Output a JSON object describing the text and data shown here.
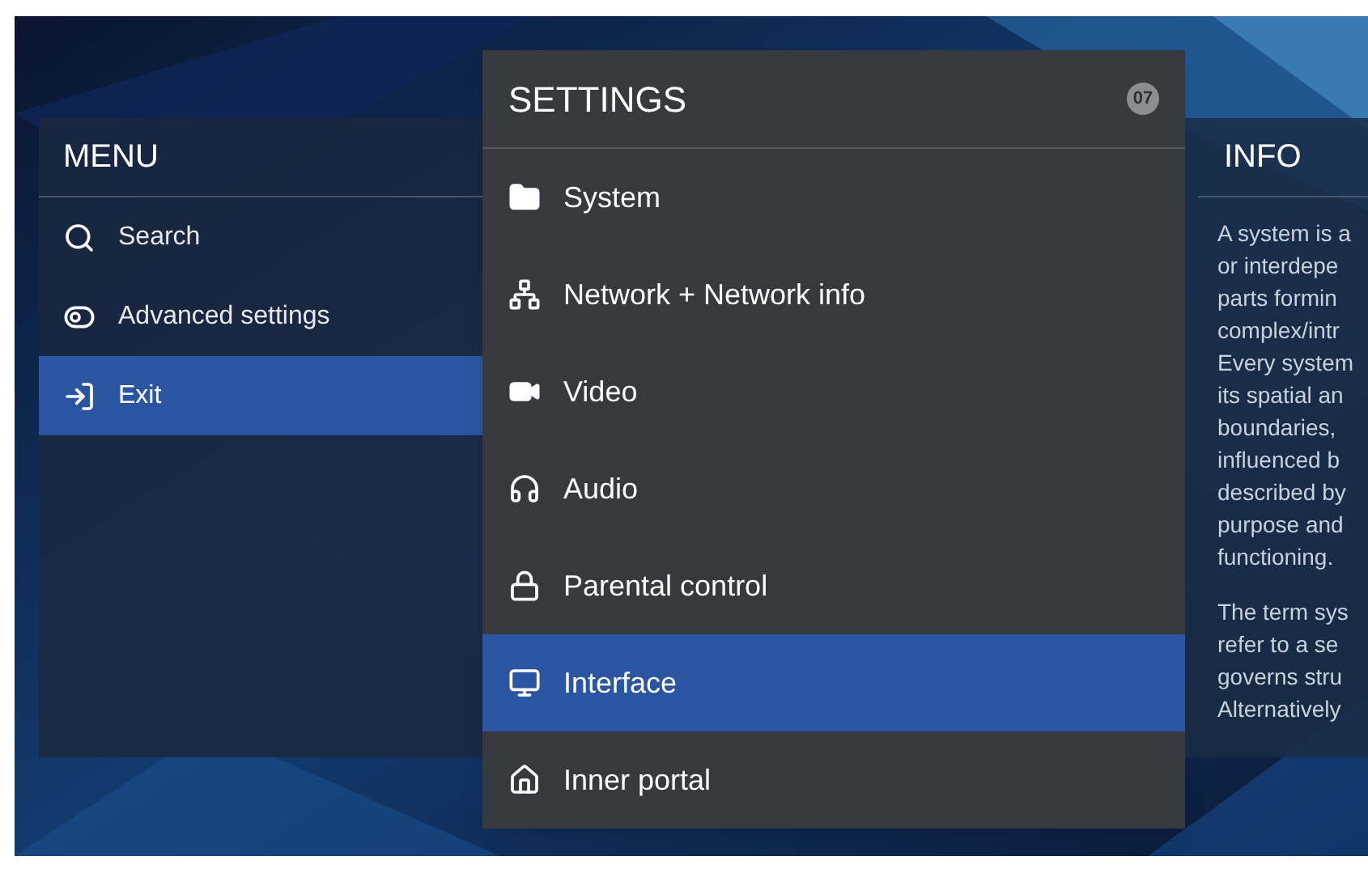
{
  "menu": {
    "title": "MENU",
    "items": [
      {
        "label": "Search",
        "selected": false
      },
      {
        "label": "Advanced settings",
        "selected": false
      },
      {
        "label": "Exit",
        "selected": true
      }
    ]
  },
  "settings": {
    "title": "SETTINGS",
    "badge": "07",
    "items": [
      {
        "label": "System",
        "selected": false
      },
      {
        "label": "Network + Network info",
        "selected": false
      },
      {
        "label": "Video",
        "selected": false
      },
      {
        "label": "Audio",
        "selected": false
      },
      {
        "label": "Parental control",
        "selected": false
      },
      {
        "label": "Interface",
        "selected": true
      },
      {
        "label": "Inner portal",
        "selected": false
      }
    ]
  },
  "info": {
    "title": "INFO",
    "paragraphs": [
      [
        "A system is a",
        "or interdepe",
        "parts formin",
        "complex/intr",
        "Every system",
        "its spatial an",
        "boundaries,",
        "influenced b",
        "described by",
        "purpose and",
        "functioning."
      ],
      [
        "The term sys",
        "refer to a se",
        "governs stru",
        "Alternatively"
      ]
    ]
  }
}
